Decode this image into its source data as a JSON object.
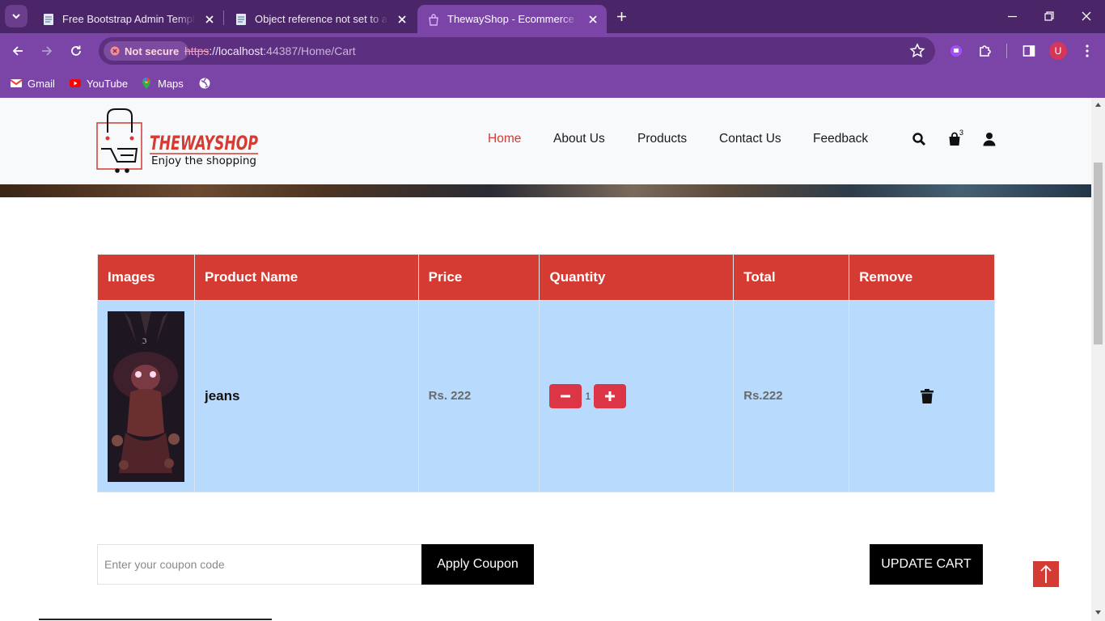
{
  "browser": {
    "tabs": [
      {
        "title": "Free Bootstrap Admin Template",
        "active": false
      },
      {
        "title": "Object reference not set to an instance",
        "active": false
      },
      {
        "title": "ThewayShop - Ecommerce Bootstrap",
        "active": true
      }
    ],
    "security_label": "Not secure",
    "url_scheme": "https",
    "url_host": "://localhost",
    "url_path": ":44387/Home/Cart",
    "profile_initial": "U",
    "bookmarks": [
      {
        "label": "Gmail",
        "icon": "gmail-icon"
      },
      {
        "label": "YouTube",
        "icon": "youtube-icon"
      },
      {
        "label": "Maps",
        "icon": "maps-icon"
      }
    ]
  },
  "site": {
    "logo_title": "THEWAYSHOP",
    "logo_tagline": "Enjoy the shopping",
    "nav": [
      "Home",
      "About Us",
      "Products",
      "Contact Us",
      "Feedback"
    ],
    "active_nav": "Home",
    "cart_count": "3"
  },
  "cart": {
    "headers": [
      "Images",
      "Product Name",
      "Price",
      "Quantity",
      "Total",
      "Remove"
    ],
    "rows": [
      {
        "name": "jeans",
        "price": "Rs. 222",
        "quantity": "1",
        "total": "Rs.222"
      }
    ]
  },
  "coupon": {
    "placeholder": "Enter your coupon code",
    "apply_label": "Apply Coupon"
  },
  "update_label": "UPDATE CART",
  "colors": {
    "accent": "#d33b33",
    "row_bg": "#b8dafd",
    "chrome": "#7a45a6",
    "qty_button": "#dc3545"
  }
}
